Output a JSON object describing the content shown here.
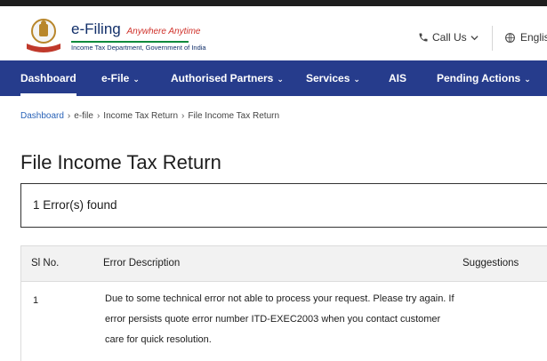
{
  "header": {
    "brand_title": "e-Filing",
    "brand_tagline": "Anywhere Anytime",
    "brand_subtitle": "Income Tax Department, Government of India",
    "call_us": "Call Us",
    "language": "English"
  },
  "nav": {
    "items": [
      {
        "label": "Dashboard",
        "dropdown": false,
        "active": true
      },
      {
        "label": "e-File",
        "dropdown": true,
        "active": false
      },
      {
        "label": "Authorised Partners",
        "dropdown": true,
        "active": false
      },
      {
        "label": "Services",
        "dropdown": true,
        "active": false
      },
      {
        "label": "AIS",
        "dropdown": false,
        "active": false
      },
      {
        "label": "Pending Actions",
        "dropdown": true,
        "active": false
      }
    ]
  },
  "breadcrumb": [
    "Dashboard",
    "e-file",
    "Income Tax Return",
    "File Income Tax Return"
  ],
  "page_title": "File Income Tax Return",
  "errors_found": "1 Error(s) found",
  "table": {
    "headers": [
      "Sl No.",
      "Error Description",
      "Suggestions"
    ],
    "rows": [
      {
        "sl": "1",
        "description": "Due to some technical error not able to process your request. Please try again. If error persists quote error number ITD-EXEC2003 when you contact customer care for quick resolution.",
        "suggestions": ""
      }
    ]
  },
  "colors": {
    "nav_bg": "#263c8c",
    "brand_blue": "#13306a",
    "link": "#2a63b8",
    "tagline_red": "#d0322b",
    "accent_green": "#0f8a3c"
  }
}
